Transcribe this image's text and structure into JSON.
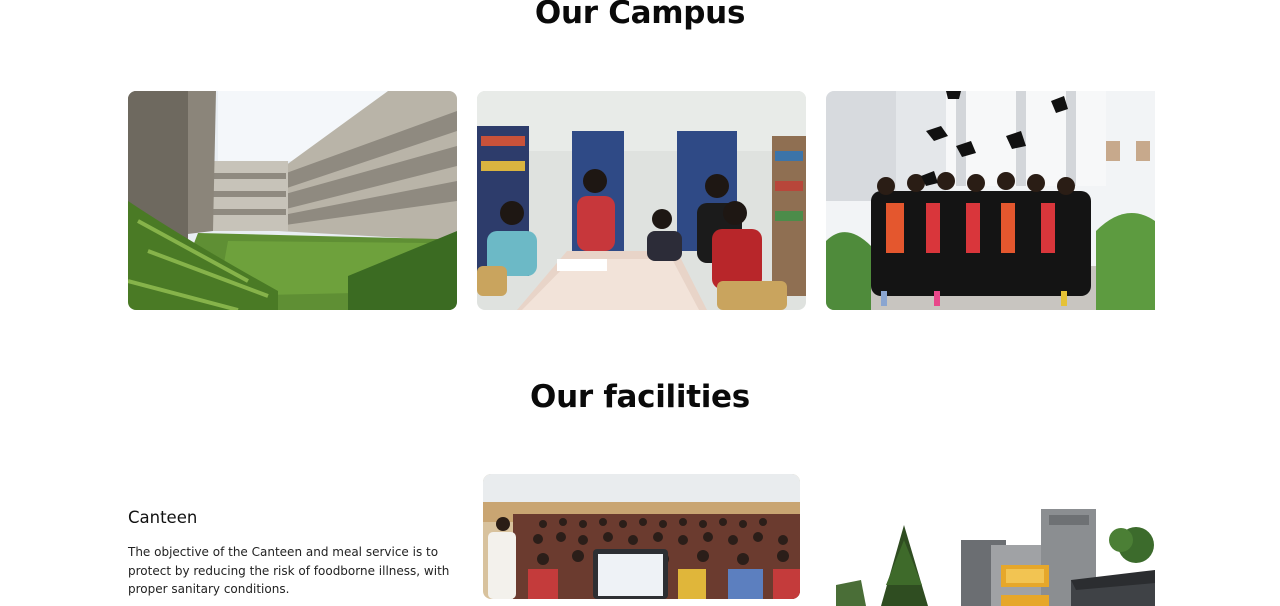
{
  "campus": {
    "title": "Our Campus",
    "photos": [
      {
        "icon": "campus-courtyard-photo"
      },
      {
        "icon": "library-students-photo"
      },
      {
        "icon": "graduation-caps-photo"
      }
    ]
  },
  "facilities": {
    "title": "Our facilities",
    "items": [
      {
        "heading": "Canteen",
        "description": "The objective of the Canteen and meal service is to protect by reducing the risk of foodborne illness, with proper sanitary conditions."
      }
    ],
    "photos": [
      {
        "icon": "auditorium-seminar-photo"
      },
      {
        "icon": "building-exterior-photo"
      }
    ]
  },
  "colors": {
    "text": "#0a0a0a",
    "background": "#ffffff"
  }
}
